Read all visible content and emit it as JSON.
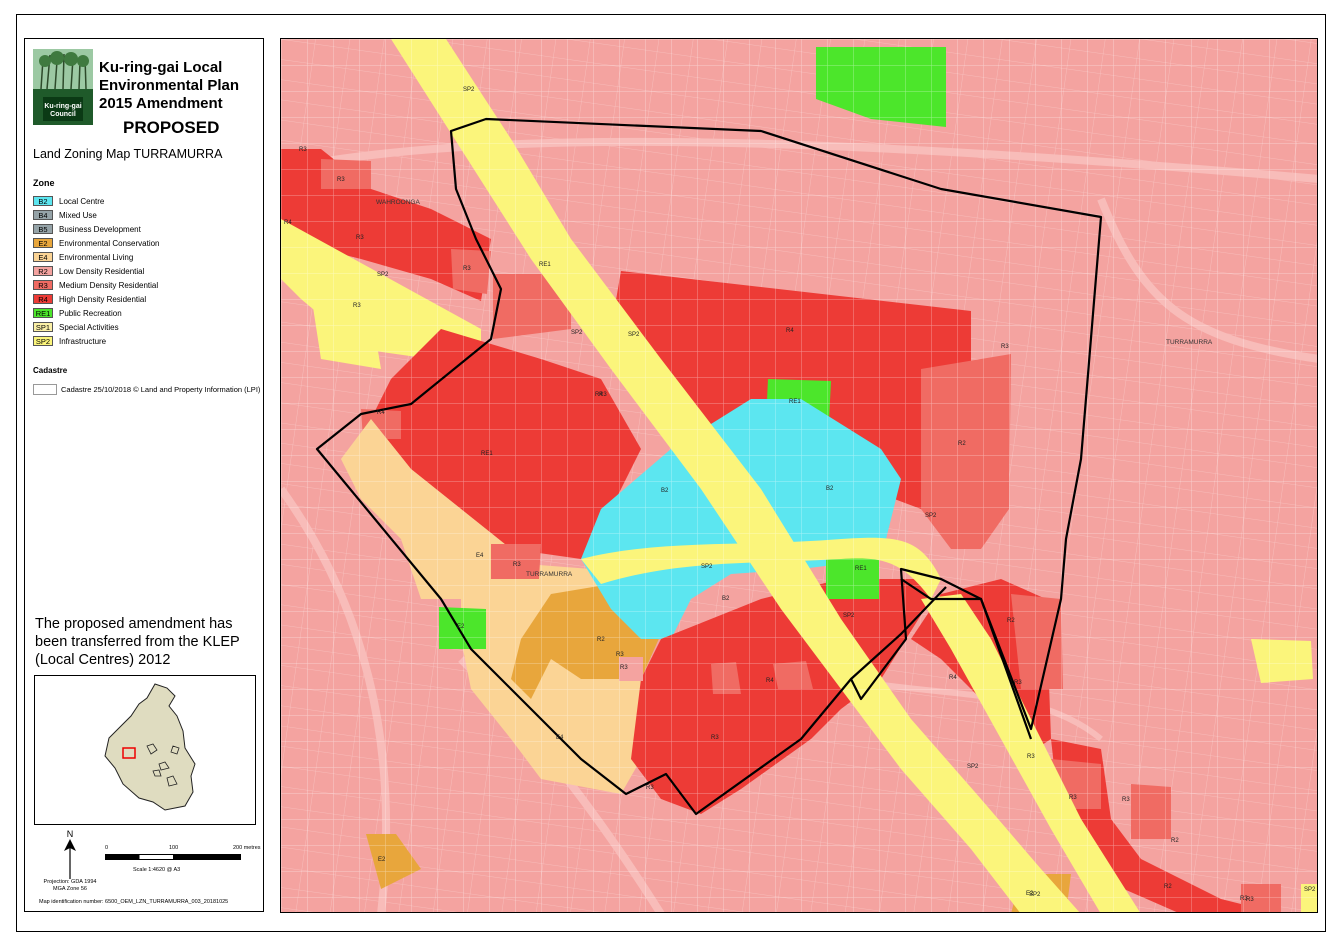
{
  "header": {
    "title": "Ku-ring-gai Local Environmental Plan 2015 Amendment",
    "status": "PROPOSED",
    "map_title": "Land Zoning Map TURRAMURRA",
    "logo_text": "Ku-ring-gai Council"
  },
  "legend": {
    "zone_heading": "Zone",
    "zones": [
      {
        "code": "B2",
        "label": "Local Centre",
        "color": "#5ce6f0"
      },
      {
        "code": "B4",
        "label": "Mixed Use",
        "color": "#95a3a8"
      },
      {
        "code": "B5",
        "label": "Business Development",
        "color": "#95a3a8"
      },
      {
        "code": "E2",
        "label": "Environmental Conservation",
        "color": "#e8a63c"
      },
      {
        "code": "E4",
        "label": "Environmental Living",
        "color": "#fbd495"
      },
      {
        "code": "R2",
        "label": "Low Density Residential",
        "color": "#f4a3a0"
      },
      {
        "code": "R3",
        "label": "Medium Density Residential",
        "color": "#f06b63"
      },
      {
        "code": "R4",
        "label": "High Density Residential",
        "color": "#ed3b36"
      },
      {
        "code": "RE1",
        "label": "Public Recreation",
        "color": "#4ce62b"
      },
      {
        "code": "SP1",
        "label": "Special Activities",
        "color": "#fbf0a6"
      },
      {
        "code": "SP2",
        "label": "Infrastructure",
        "color": "#fbf57b"
      }
    ],
    "cadastre_heading": "Cadastre",
    "cadastre_label": "Cadastre 25/10/2018 © Land and Property Information (LPI)"
  },
  "note": "The proposed amendment has been transferred from the KLEP (Local Centres) 2012",
  "scale": {
    "north": "N",
    "ticks": [
      "0",
      "100",
      "200 metres"
    ],
    "scale_text": "Scale   1:4620   @ A3",
    "projection": "Projection: GDA 1994 MGA Zone 56"
  },
  "map_id": "Map identification number:   6500_OEM_LZN_TURRAMURRA_003_20181025",
  "map_labels": {
    "localities": [
      "WAHROONGA",
      "TURRAMURRA",
      "TURRAMURRA"
    ],
    "zones": [
      "R3",
      "R3",
      "R3",
      "R4",
      "R3",
      "SP2",
      "SP2",
      "R3",
      "RE1",
      "SP2",
      "SP2",
      "R4",
      "R3",
      "RE1",
      "R4",
      "R4",
      "R3",
      "B2",
      "B2",
      "SP2",
      "R3",
      "R2",
      "E4",
      "SP2",
      "B2",
      "RE1",
      "RE1",
      "E2",
      "R2",
      "R3",
      "R3",
      "R4",
      "R4",
      "E4",
      "R3",
      "R2",
      "R3",
      "SP2",
      "R3",
      "SP2",
      "R3",
      "R3",
      "R3",
      "R2",
      "E2",
      "R2",
      "R3",
      "SP2",
      "E2",
      "SP2",
      "R3"
    ]
  }
}
